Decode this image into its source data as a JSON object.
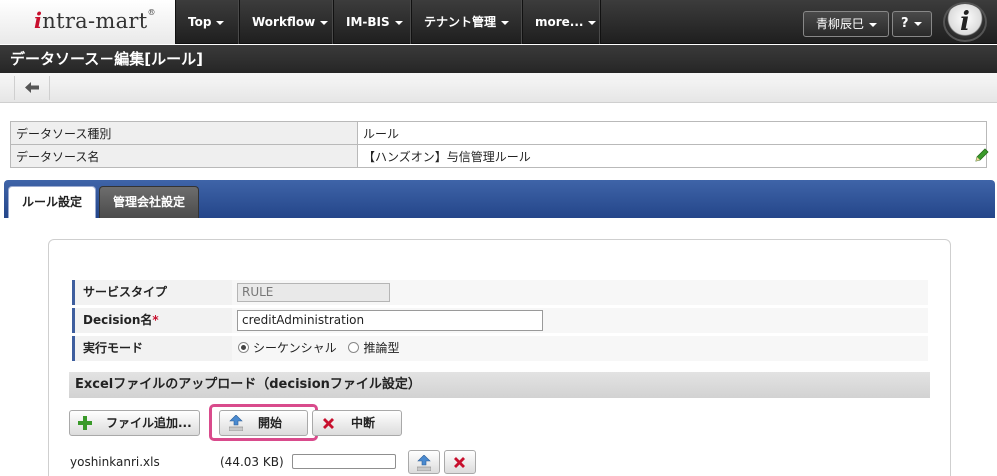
{
  "app": {
    "logo_text_i": "i",
    "logo_text_rest": "ntra-mart",
    "logo_mark": "®"
  },
  "nav": {
    "items": [
      {
        "label": "Top"
      },
      {
        "label": "Workflow"
      },
      {
        "label": "IM-BIS"
      },
      {
        "label": "テナント管理"
      },
      {
        "label": "more..."
      }
    ],
    "user_name": "青柳辰巳",
    "help_label": "?",
    "brand_icon": "i"
  },
  "page": {
    "title": "データソース－編集[ルール]",
    "back_icon": "arrow-left-icon"
  },
  "info": {
    "rows": [
      {
        "label": "データソース種別",
        "value": "ルール"
      },
      {
        "label": "データソース名",
        "value": "【ハンズオン】与信管理ルール"
      }
    ]
  },
  "tabs": [
    {
      "label": "ルール設定",
      "active": true
    },
    {
      "label": "管理会社設定",
      "active": false
    }
  ],
  "form": {
    "service_type_label": "サービスタイプ",
    "service_type_value": "RULE",
    "decision_label": "Decision名",
    "decision_required": "*",
    "decision_value": "creditAdministration",
    "mode_label": "実行モード",
    "mode_options": [
      {
        "label": "シーケンシャル",
        "selected": true
      },
      {
        "label": "推論型",
        "selected": false
      }
    ]
  },
  "upload": {
    "section_title": "Excelファイルのアップロード（decisionファイル設定）",
    "add_label": "ファイル追加...",
    "start_label": "開始",
    "cancel_label": "中断",
    "file": {
      "name": "yoshinkanri.xls",
      "size": "(44.03 KB)",
      "progress_percent": 0
    }
  },
  "colors": {
    "nav_bg": "#2b2b2b",
    "tab_bar": "#2f55a0",
    "highlight": "#d94b8c",
    "required": "#c8102e",
    "accent_green": "#3a9a2a",
    "cancel_red": "#c8102e"
  }
}
